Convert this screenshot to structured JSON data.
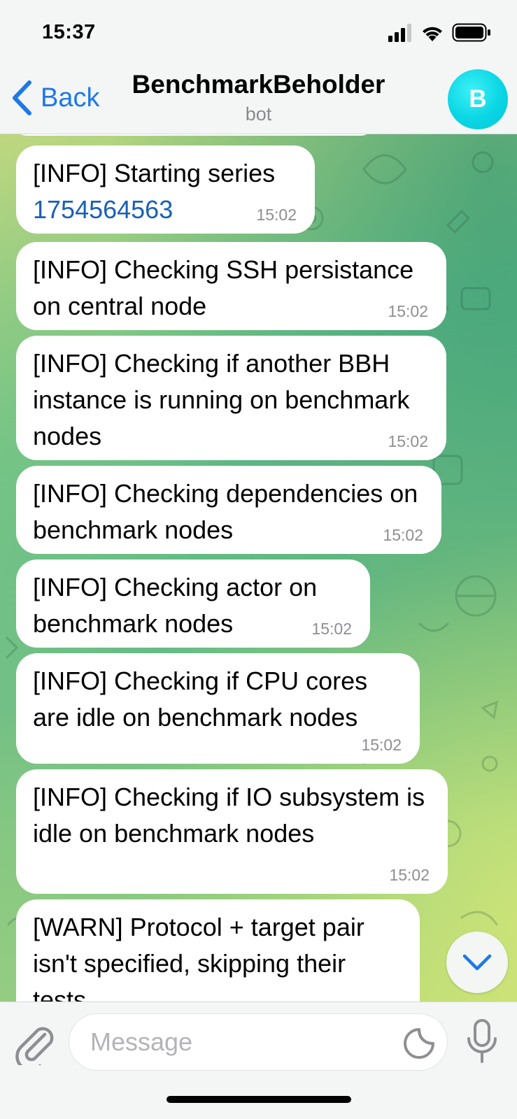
{
  "status_bar": {
    "time": "15:37",
    "icons": [
      "signal-icon",
      "wifi-icon",
      "battery-icon"
    ]
  },
  "header": {
    "back_label": "Back",
    "title": "BenchmarkBeholder",
    "subtitle": "bot",
    "avatar_letter": "B",
    "avatar_color": "#0ad6e4",
    "accent_color": "#1e79e6"
  },
  "messages": [
    {
      "prefix": "[INFO] Starting series ",
      "link": "1754564563",
      "time": "15:02"
    },
    {
      "text": "[INFO] Checking SSH persistance on central node",
      "time": "15:02"
    },
    {
      "text": "[INFO] Checking if another BBH instance is running on benchmark nodes",
      "time": "15:02"
    },
    {
      "text": "[INFO] Checking dependencies on benchmark nodes",
      "time": "15:02"
    },
    {
      "text": "[INFO] Checking actor on benchmark nodes",
      "time": "15:02"
    },
    {
      "text": "[INFO] Checking if CPU cores are idle on benchmark nodes",
      "time": "15:02"
    },
    {
      "text": "[INFO] Checking if IO subsystem is idle on benchmark nodes",
      "time": "15:02"
    },
    {
      "text": "[WARN] Protocol + target pair isn't specified, skipping their tests"
    }
  ],
  "composer": {
    "placeholder": "Message",
    "icons": [
      "paperclip-icon",
      "sticker-icon",
      "microphone-icon"
    ]
  },
  "scroll_down_icon": "chevron-down-icon"
}
